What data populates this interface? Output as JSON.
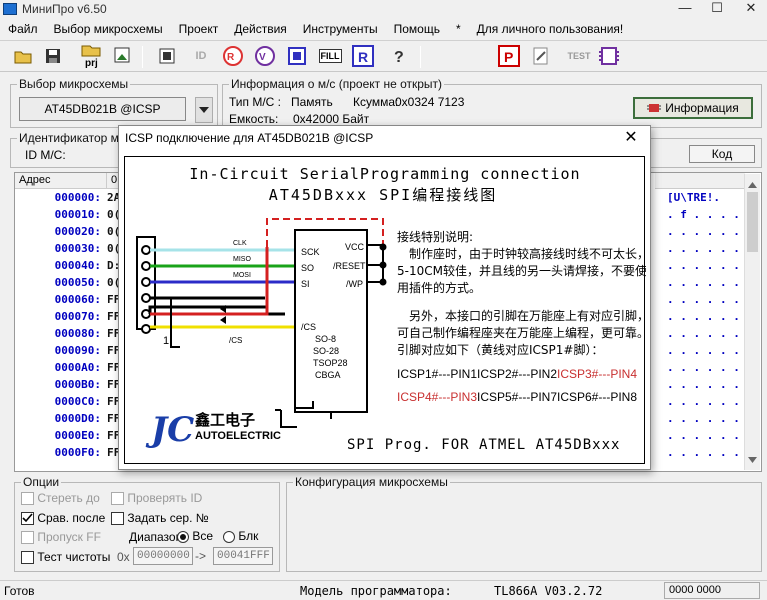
{
  "window": {
    "title": "МиниПро v6.50"
  },
  "menu": [
    "Файл",
    "Выбор микросхемы",
    "Проект",
    "Действия",
    "Инструменты",
    "Помощь",
    "*",
    "Для личного пользования!"
  ],
  "toolbar": {
    "prj_label": "prj",
    "id_label": "ID",
    "fill_label": "FILL",
    "test_label": "TEST"
  },
  "chip_select": {
    "label": "Выбор микросхемы",
    "value": "AT45DB021B @ICSP"
  },
  "info": {
    "label": "Информация о м/с (проект не открыт)",
    "type_label": "Тип М/С :",
    "type_value": "Память",
    "checksum_label": "Ксумма:",
    "checksum_value": "0x0324 7123",
    "capacity_label": "Емкость:",
    "capacity_value": "0x42000 Байт",
    "info_button": "Информация"
  },
  "chip_id": {
    "label": "Идентификатор ми",
    "id_label": "ID М/С:",
    "code_button": "Код"
  },
  "hex": {
    "addr_header": "Адрес",
    "col0_header": "0",
    "rows": [
      {
        "addr": "000000:",
        "b0": "2A"
      },
      {
        "addr": "000010:",
        "b0": "0("
      },
      {
        "addr": "000020:",
        "b0": "0("
      },
      {
        "addr": "000030:",
        "b0": "0("
      },
      {
        "addr": "000040:",
        "b0": "D:"
      },
      {
        "addr": "000050:",
        "b0": "0("
      },
      {
        "addr": "000060:",
        "b0": "FF"
      },
      {
        "addr": "000070:",
        "b0": "FF"
      },
      {
        "addr": "000080:",
        "b0": "FF"
      },
      {
        "addr": "000090:",
        "b0": "FF"
      },
      {
        "addr": "0000A0:",
        "b0": "FF"
      },
      {
        "addr": "0000B0:",
        "b0": "FF"
      },
      {
        "addr": "0000C0:",
        "b0": "FF"
      },
      {
        "addr": "0000D0:",
        "b0": "FF"
      },
      {
        "addr": "0000E0:",
        "b0": "FF"
      },
      {
        "addr": "0000F0:",
        "b0": "FF"
      }
    ],
    "ascii": [
      "[U\\TRE!.",
      ". f . . . . .",
      ". . . . . . .",
      ". . . . . . .",
      ". . . . . . .",
      ". . . . . . .",
      ". . . . . . .",
      ". . . . . . .",
      ". . . . . . .",
      ". . . . . . .",
      ". . . . . . .",
      ". . . . . . .",
      ". . . . . . .",
      ". . . . . . .",
      ". . . . . . .",
      ". . . . . . ."
    ]
  },
  "dialog": {
    "title": "ICSP подключение для AT45DB021B @ICSP",
    "heading1": "In-Circuit SerialProgramming connection",
    "heading2": "AT45DBxxx SPI编程接线图",
    "pin_labels": {
      "clk": "CLK",
      "miso": "MISO",
      "mosi": "MOSI",
      "cs": "/CS",
      "one": "1"
    },
    "chip_pins": {
      "sck": "SCK",
      "so": "SO",
      "si": "SI",
      "cs": "/CS",
      "vcc": "VCC",
      "reset": "/RESET",
      "wp": "/WP"
    },
    "packages": [
      "SO-8",
      "SO-28",
      "TSOP28",
      "CBGA"
    ],
    "notes_title": "接线特别说明:",
    "notes": [
      "制作座时，由于时钟较高接线时线不可太长，",
      "5-10CM较佳，并且线的另一头请焊接，不要使",
      "用插件的方式。",
      "另外，本接口的引脚在万能座上有对应引脚，",
      "可自己制作编程座夹在万能座上编程，更可靠。",
      "引脚对应如下（黄线对应ICSP1#脚）："
    ],
    "map_row1": [
      "ICSP1#---PIN1",
      "ICSP2#---PIN2",
      "ICSP3#---PIN4"
    ],
    "map_row2": [
      "ICSP4#---PIN3",
      "ICSP5#---PIN7",
      "ICSP6#---PIN8"
    ],
    "logo_cn": "鑫工电子",
    "logo_en": "AUTOELECTRIC",
    "footer": "SPI Prog.  FOR  ATMEL AT45DBxxx",
    "close_glyph": "✕"
  },
  "options": {
    "label": "Опции",
    "erase": "Стереть до",
    "verify_id": "Проверять ID",
    "compare_after": "Срав. после",
    "set_serial": "Задать сер. №",
    "skip_ff": "Пропуск FF",
    "range_label": "Диапазон",
    "all": "Все",
    "block": "Блк",
    "blank_test": "Тест чистоты",
    "hex_prefix": "0x",
    "range_from": "00000000",
    "arrow": "->",
    "range_to": "00041FFF"
  },
  "config": {
    "label": "Конфигурация микросхемы"
  },
  "status": {
    "ready": "Готов",
    "model_label": "Модель программатора:",
    "model_value": "TL866A V03.2.72",
    "counter": "0000 0000"
  },
  "colors": {
    "clk": "#a6e3e8",
    "miso": "#19a319",
    "mosi": "#2b2bc8",
    "red": "#d42020",
    "yellow": "#f0e000",
    "black": "#000000",
    "chip_red": "#c83030",
    "logo_blue": "#1a3ea8"
  }
}
